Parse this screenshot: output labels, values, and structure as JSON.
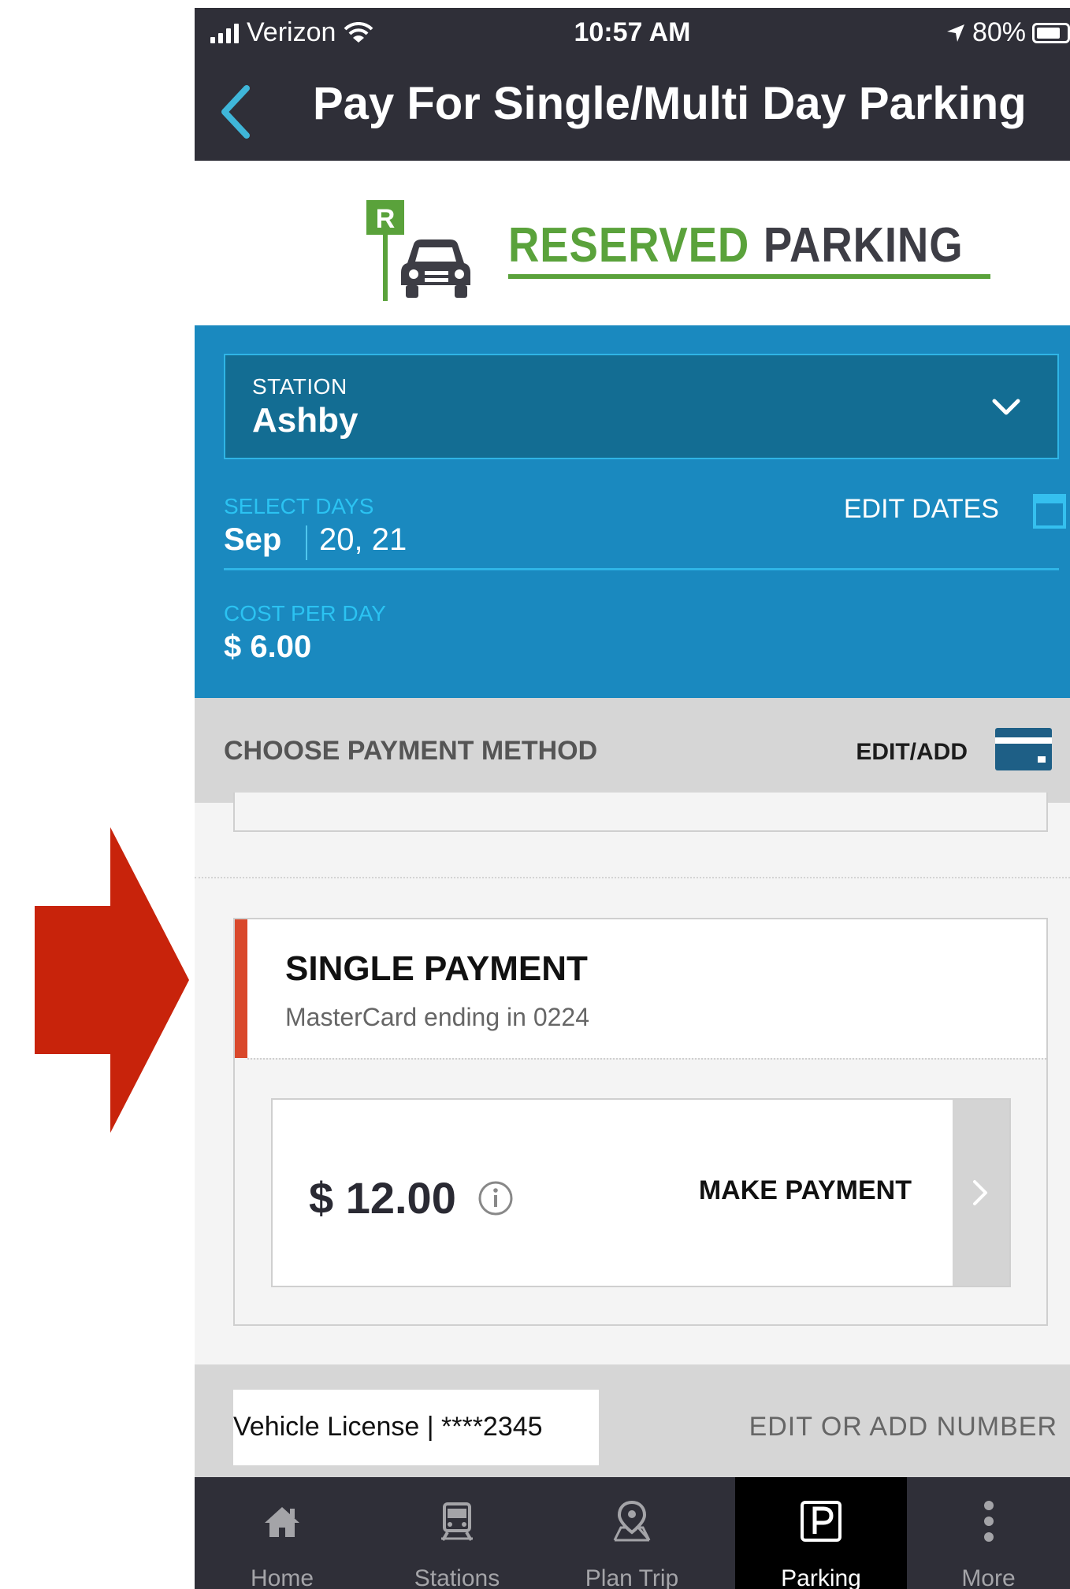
{
  "status_bar": {
    "carrier": "Verizon",
    "time": "10:57 AM",
    "battery": "80%"
  },
  "header": {
    "title": "Pay For Single/Multi Day Parking"
  },
  "logo": {
    "badge_letter": "R",
    "word_green": "RESERVED",
    "word_dark": "PARKING",
    "green_color": "#5aa23b"
  },
  "station": {
    "label": "STATION",
    "value": "Ashby"
  },
  "days": {
    "label": "SELECT DAYS",
    "month": "Sep",
    "dates": "20, 21",
    "edit_label": "EDIT DATES"
  },
  "cost": {
    "label": "COST PER DAY",
    "value": "$ 6.00"
  },
  "payment_method": {
    "title": "CHOOSE PAYMENT METHOD",
    "edit_label": "EDIT/ADD"
  },
  "payment_card": {
    "title": "SINGLE PAYMENT",
    "subtitle": "MasterCard ending in 0224",
    "amount": "$ 12.00",
    "action_label": "MAKE PAYMENT",
    "accent_color": "#d9482b"
  },
  "vehicle": {
    "license": "Vehicle License | ****2345",
    "edit_label": "EDIT OR ADD NUMBER"
  },
  "tabs": [
    {
      "label": "Home",
      "icon": "home-icon",
      "active": false
    },
    {
      "label": "Stations",
      "icon": "train-icon",
      "active": false
    },
    {
      "label": "Plan Trip",
      "icon": "map-pin-icon",
      "active": false
    },
    {
      "label": "Parking",
      "icon": "parking-icon",
      "active": true
    },
    {
      "label": "More",
      "icon": "more-icon",
      "active": false
    }
  ],
  "colors": {
    "header_bg": "#2f2f38",
    "blue_section": "#1a89bf",
    "annotation_arrow": "#c8230b"
  }
}
